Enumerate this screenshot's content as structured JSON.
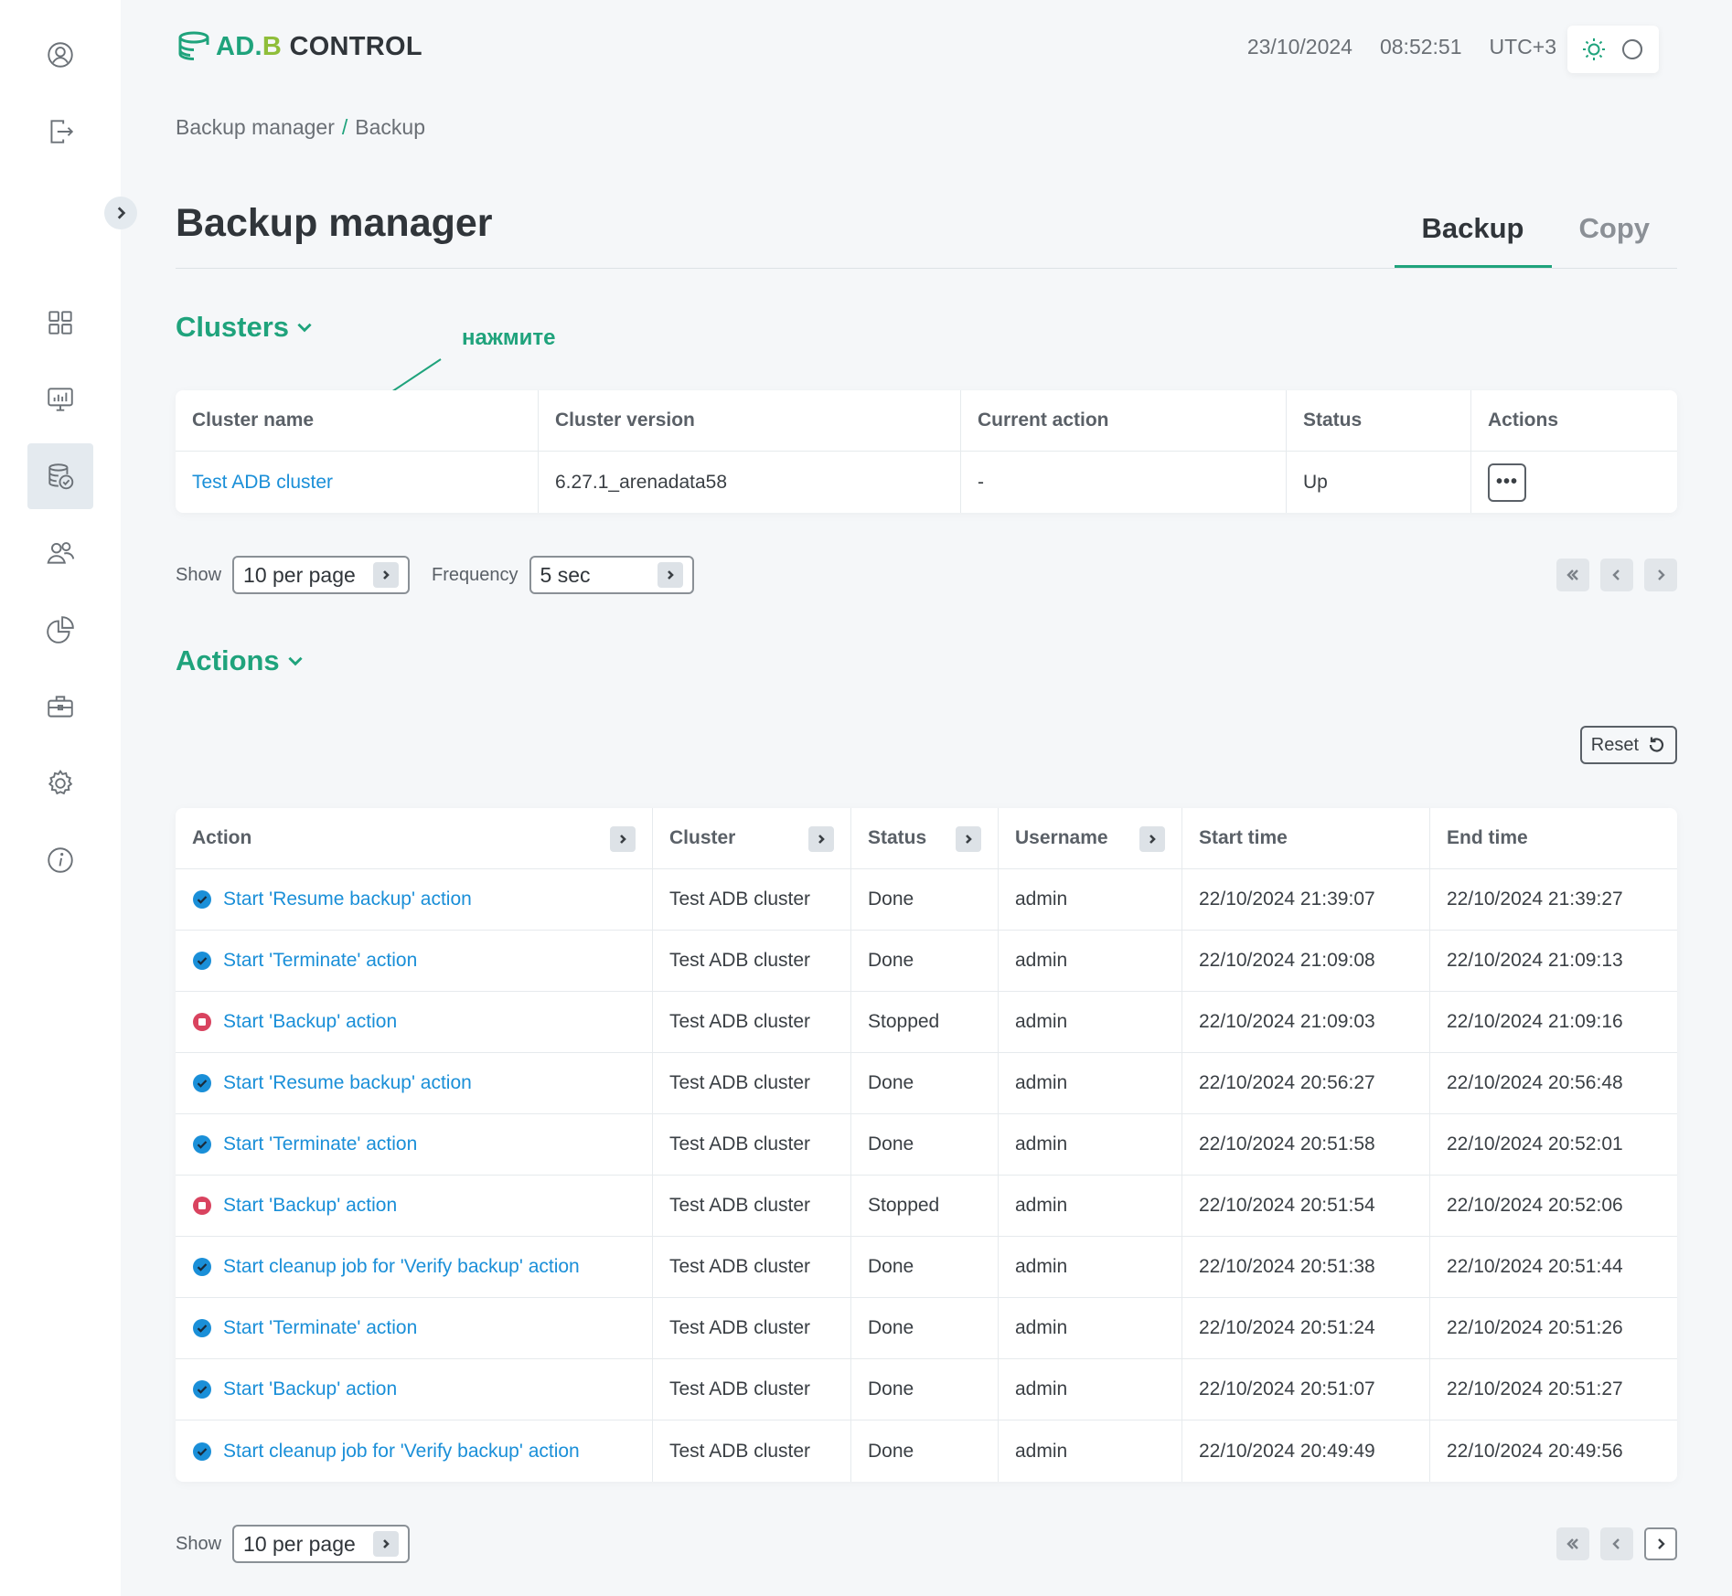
{
  "header": {
    "logo": {
      "part1": "AD.",
      "part2": "B",
      "part3": " CONTROL"
    },
    "date": "23/10/2024",
    "time": "08:52:51",
    "timezone": "UTC+3"
  },
  "sidebar": {
    "icons": [
      "user-icon",
      "logout-icon",
      "dashboard-icon",
      "monitoring-icon",
      "backup-icon",
      "users-icon",
      "reports-icon",
      "tools-icon",
      "settings-icon",
      "info-icon"
    ],
    "active": "backup-icon"
  },
  "breadcrumb": {
    "parent": "Backup manager",
    "separator": "/",
    "current": "Backup"
  },
  "page": {
    "title": "Backup manager"
  },
  "tabs": [
    {
      "label": "Backup",
      "active": true
    },
    {
      "label": "Copy",
      "active": false
    }
  ],
  "clusters": {
    "title": "Clusters",
    "annotation": "нажмите",
    "headers": [
      "Cluster name",
      "Cluster version",
      "Current action",
      "Status",
      "Actions"
    ],
    "rows": [
      {
        "name": "Test ADB cluster",
        "version": "6.27.1_arenadata58",
        "current_action": "-",
        "status": "Up"
      }
    ],
    "show_label": "Show",
    "per_page": "10 per page",
    "frequency_label": "Frequency",
    "frequency": "5 sec"
  },
  "actions": {
    "title": "Actions",
    "reset_label": "Reset",
    "headers": [
      "Action",
      "Cluster",
      "Status",
      "Username",
      "Start time",
      "End time"
    ],
    "rows": [
      {
        "action": "Start 'Resume backup' action",
        "cluster": "Test ADB cluster",
        "status": "Done",
        "user": "admin",
        "start": "22/10/2024 21:39:07",
        "end": "22/10/2024 21:39:27"
      },
      {
        "action": "Start 'Terminate' action",
        "cluster": "Test ADB cluster",
        "status": "Done",
        "user": "admin",
        "start": "22/10/2024 21:09:08",
        "end": "22/10/2024 21:09:13"
      },
      {
        "action": "Start 'Backup' action",
        "cluster": "Test ADB cluster",
        "status": "Stopped",
        "user": "admin",
        "start": "22/10/2024 21:09:03",
        "end": "22/10/2024 21:09:16"
      },
      {
        "action": "Start 'Resume backup' action",
        "cluster": "Test ADB cluster",
        "status": "Done",
        "user": "admin",
        "start": "22/10/2024 20:56:27",
        "end": "22/10/2024 20:56:48"
      },
      {
        "action": "Start 'Terminate' action",
        "cluster": "Test ADB cluster",
        "status": "Done",
        "user": "admin",
        "start": "22/10/2024 20:51:58",
        "end": "22/10/2024 20:52:01"
      },
      {
        "action": "Start 'Backup' action",
        "cluster": "Test ADB cluster",
        "status": "Stopped",
        "user": "admin",
        "start": "22/10/2024 20:51:54",
        "end": "22/10/2024 20:52:06"
      },
      {
        "action": "Start cleanup job for 'Verify backup' action",
        "cluster": "Test ADB cluster",
        "status": "Done",
        "user": "admin",
        "start": "22/10/2024 20:51:38",
        "end": "22/10/2024 20:51:44"
      },
      {
        "action": "Start 'Terminate' action",
        "cluster": "Test ADB cluster",
        "status": "Done",
        "user": "admin",
        "start": "22/10/2024 20:51:24",
        "end": "22/10/2024 20:51:26"
      },
      {
        "action": "Start 'Backup' action",
        "cluster": "Test ADB cluster",
        "status": "Done",
        "user": "admin",
        "start": "22/10/2024 20:51:07",
        "end": "22/10/2024 20:51:27"
      },
      {
        "action": "Start cleanup job for 'Verify backup' action",
        "cluster": "Test ADB cluster",
        "status": "Done",
        "user": "admin",
        "start": "22/10/2024 20:49:49",
        "end": "22/10/2024 20:49:56"
      }
    ],
    "show_label": "Show",
    "per_page": "10 per page"
  },
  "colors": {
    "accent": "#1fa37c",
    "link": "#1a8fd8",
    "done": "#1a8fd8",
    "stopped": "#d9435f"
  }
}
